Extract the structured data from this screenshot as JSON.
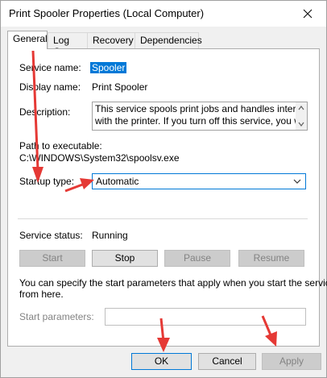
{
  "window": {
    "title": "Print Spooler Properties (Local Computer)"
  },
  "tabs": [
    {
      "label": "General",
      "active": true
    },
    {
      "label": "Log On"
    },
    {
      "label": "Recovery"
    },
    {
      "label": "Dependencies"
    }
  ],
  "general": {
    "service_name_label": "Service name:",
    "service_name_value": "Spooler",
    "display_name_label": "Display name:",
    "display_name_value": "Print Spooler",
    "description_label": "Description:",
    "description_line1": "This service spools print jobs and handles interaction",
    "description_line2": "with the printer.  If you turn off this service, you won't",
    "path_label": "Path to executable:",
    "path_value": "C:\\WINDOWS\\System32\\spoolsv.exe",
    "startup_type_label": "Startup type:",
    "startup_type_value": "Automatic",
    "service_status_label": "Service status:",
    "service_status_value": "Running",
    "start_label": "Start",
    "stop_label": "Stop",
    "pause_label": "Pause",
    "resume_label": "Resume",
    "hint_line1": "You can specify the start parameters that apply when you start the service",
    "hint_line2": "from here.",
    "start_params_label": "Start parameters:"
  },
  "footer": {
    "ok_label": "OK",
    "cancel_label": "Cancel",
    "apply_label": "Apply"
  },
  "colors": {
    "accent": "#0078d7",
    "annotation_arrow": "#e53935"
  }
}
